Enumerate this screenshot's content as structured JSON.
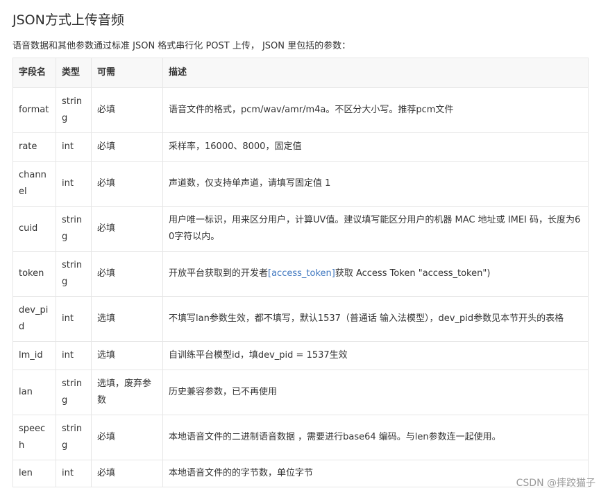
{
  "title": "JSON方式上传音频",
  "intro": "语音数据和其他参数通过标准 JSON 格式串行化 POST 上传， JSON 里包括的参数：",
  "table": {
    "headers": [
      "字段名",
      "类型",
      "可需",
      "描述"
    ],
    "rows": [
      {
        "name": "format",
        "type": "string",
        "req": "必填",
        "desc": "语音文件的格式，pcm/wav/amr/m4a。不区分大小写。推荐pcm文件"
      },
      {
        "name": "rate",
        "type": "int",
        "req": "必填",
        "desc": "采样率，16000、8000，固定值"
      },
      {
        "name": "channel",
        "type": "int",
        "req": "必填",
        "desc": "声道数，仅支持单声道，请填写固定值 1"
      },
      {
        "name": "cuid",
        "type": "string",
        "req": "必填",
        "desc": "用户唯一标识，用来区分用户，计算UV值。建议填写能区分用户的机器 MAC 地址或 IMEI 码，长度为60字符以内。"
      },
      {
        "name": "token",
        "type": "string",
        "req": "必填",
        "desc_pre": "开放平台获取到的开发者",
        "desc_link": "[access_token]",
        "desc_post": "获取 Access Token \"access_token\")"
      },
      {
        "name": "dev_pid",
        "type": "int",
        "req": "选填",
        "desc": "不填写lan参数生效，都不填写，默认1537（普通话 输入法模型），dev_pid参数见本节开头的表格"
      },
      {
        "name": "lm_id",
        "type": "int",
        "req": "选填",
        "desc": "自训练平台模型id，填dev_pid = 1537生效"
      },
      {
        "name": "lan",
        "type": "string",
        "req": "选填，废弃参数",
        "desc": "历史兼容参数，已不再使用"
      },
      {
        "name": "speech",
        "type": "string",
        "req": "必填",
        "desc": "本地语音文件的二进制语音数据 ，需要进行base64 编码。与len参数连一起使用。"
      },
      {
        "name": "len",
        "type": "int",
        "req": "必填",
        "desc": "本地语音文件的的字节数，单位字节"
      }
    ]
  },
  "watermark": "CSDN @摔跤猫子",
  "colors": {
    "link": "#4078c0",
    "header_bg": "#f8f8f8",
    "border": "#e6e6e6"
  }
}
